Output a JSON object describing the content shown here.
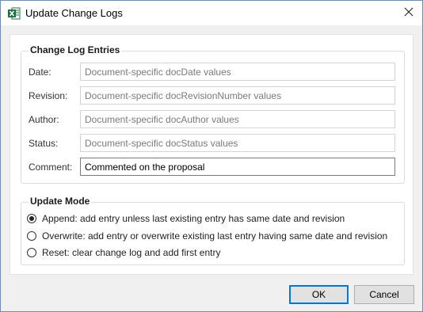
{
  "window": {
    "title": "Update Change Logs",
    "app_icon": "excel-icon",
    "close_icon": "close-icon"
  },
  "change_log": {
    "legend": "Change Log Entries",
    "rows": [
      {
        "label": "Date:",
        "value": "Document-specific docDate values",
        "editable": false
      },
      {
        "label": "Revision:",
        "value": "Document-specific docRevisionNumber values",
        "editable": false
      },
      {
        "label": "Author:",
        "value": "Document-specific docAuthor values",
        "editable": false
      },
      {
        "label": "Status:",
        "value": "Document-specific docStatus values",
        "editable": false
      },
      {
        "label": "Comment:",
        "value": "Commented on the proposal",
        "editable": true
      }
    ]
  },
  "update_mode": {
    "legend": "Update Mode",
    "options": [
      {
        "label": "Append: add entry unless last existing entry has same date and revision",
        "checked": true
      },
      {
        "label": "Overwrite: add entry or overwrite existing last entry having same date and revision",
        "checked": false
      },
      {
        "label": "Reset: clear change log and add first entry",
        "checked": false
      }
    ]
  },
  "buttons": {
    "ok": "OK",
    "cancel": "Cancel"
  },
  "colors": {
    "excel_green": "#1d6f42",
    "focus_blue": "#0078d7"
  }
}
